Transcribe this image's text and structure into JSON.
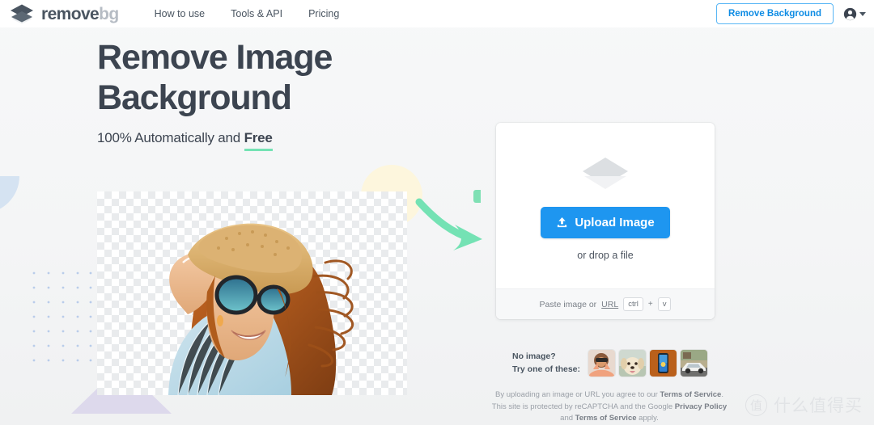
{
  "header": {
    "logo": {
      "icon": "layers-icon",
      "text_primary": "remove",
      "text_secondary": "bg"
    },
    "nav": [
      {
        "label": "How to use"
      },
      {
        "label": "Tools & API"
      },
      {
        "label": "Pricing"
      }
    ],
    "remove_background_button": "Remove Background",
    "account_icon": "account-circle-icon"
  },
  "hero": {
    "title_line1": "Remove Image",
    "title_line2": "Background",
    "subtitle_prefix": "100% Automatically and ",
    "subtitle_highlight": "Free",
    "image_alt": "woman-in-straw-hat-sunglasses-transparent-background"
  },
  "upload": {
    "layers_icon": "layers-icon",
    "button_label": "Upload Image",
    "button_icon": "upload-icon",
    "drop_text": "or drop a file",
    "paste_prefix": "Paste image or ",
    "paste_url_label": "URL",
    "kbd_ctrl": "ctrl",
    "kbd_plus": "+",
    "kbd_v": "v"
  },
  "samples": {
    "label_line1": "No image?",
    "label_line2": "Try one of these:",
    "thumbnails": [
      {
        "name": "sample-woman"
      },
      {
        "name": "sample-dog"
      },
      {
        "name": "sample-product-phone"
      },
      {
        "name": "sample-car"
      }
    ]
  },
  "legal": {
    "line1_pre": "By uploading an image or URL you agree to our ",
    "line1_link": "Terms of Service",
    "line1_post": ".",
    "line2_pre": "This site is protected by reCAPTCHA and the Google ",
    "line2_link": "Privacy Policy",
    "line3_pre": "and ",
    "line3_link": "Terms of Service",
    "line3_post": " apply."
  },
  "watermark": {
    "badge": "值",
    "text": "什么值得买"
  },
  "colors": {
    "accent_blue": "#1e96f0",
    "outline_blue": "#59b6f5",
    "mint": "#74e2b4",
    "heading": "#3c4450",
    "page_bg": "#f4f5f6",
    "lavender": "#ddd9ec",
    "cream": "#fdf6dd"
  }
}
